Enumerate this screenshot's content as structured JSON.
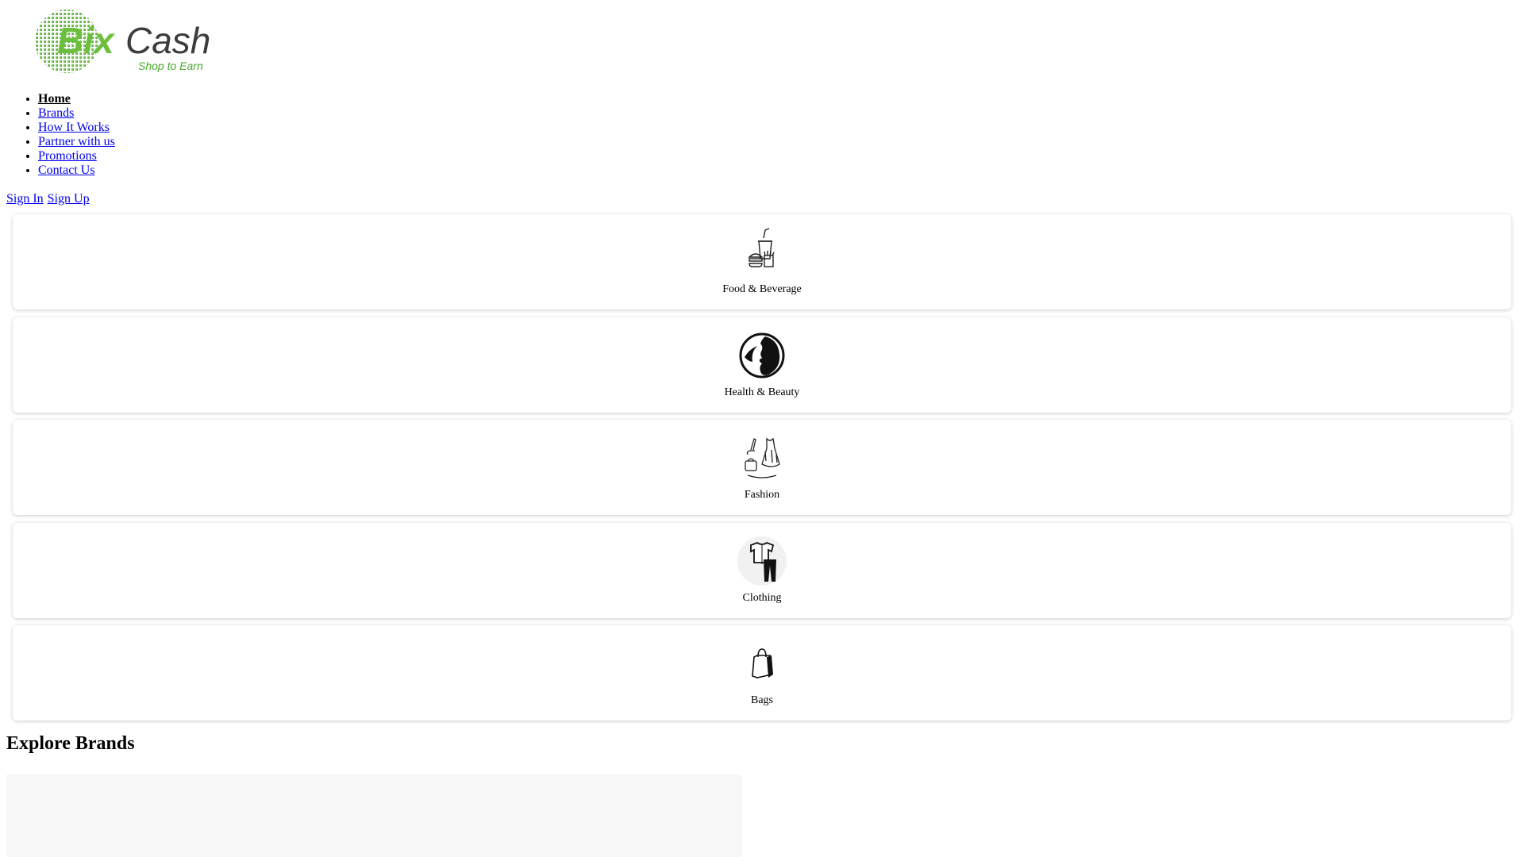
{
  "header": {
    "logo": {
      "brand_part1": "Bix",
      "brand_part2": "Cash",
      "tagline": "Shop to Earn",
      "green_color": "#6cbf3c",
      "gray_color": "#3d3d3d"
    }
  },
  "nav": {
    "items": [
      {
        "label": "Home",
        "active": true
      },
      {
        "label": "Brands",
        "active": false
      },
      {
        "label": "How It Works",
        "active": false
      },
      {
        "label": "Partner with us",
        "active": false
      },
      {
        "label": "Promotions",
        "active": false
      },
      {
        "label": "Contact Us",
        "active": false
      }
    ]
  },
  "auth": {
    "sign_in": "Sign In",
    "sign_up": "Sign Up"
  },
  "categories": [
    {
      "label": "Food & Beverage",
      "icon": "food-beverage-icon"
    },
    {
      "label": "Health & Beauty",
      "icon": "health-beauty-icon"
    },
    {
      "label": "Fashion",
      "icon": "fashion-icon"
    },
    {
      "label": "Clothing",
      "icon": "clothing-icon"
    },
    {
      "label": "Bags",
      "icon": "bags-icon"
    }
  ],
  "explore": {
    "title": "Explore Brands"
  }
}
